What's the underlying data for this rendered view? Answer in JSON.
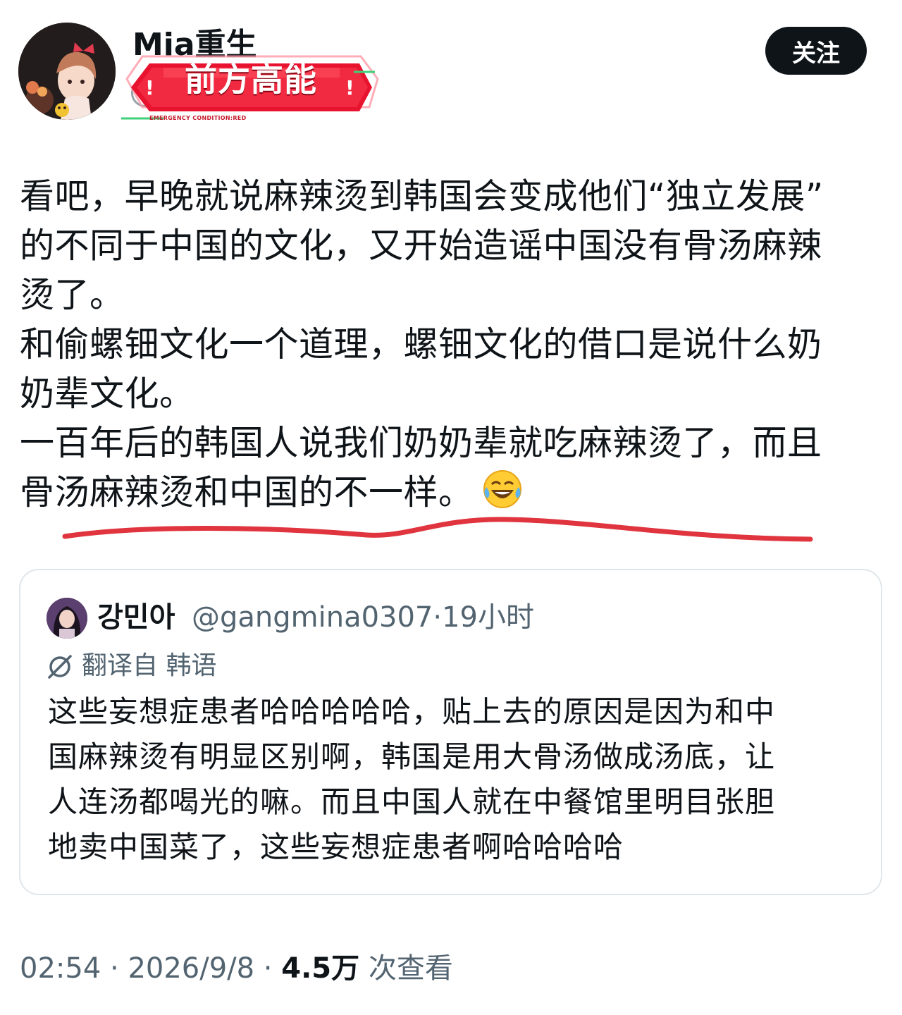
{
  "author": {
    "name": "Mia重生",
    "avatar_icon": "anime-girl-avatar-icon"
  },
  "sticker": {
    "text": "前方高能",
    "subtext": "EMERGENCY CONDITION:RED"
  },
  "follow_label": "关注",
  "post": {
    "lines": [
      "看吧，早晚就说麻辣烫到韩国会变成他们“独立发展”",
      "的不同于中国的文化，又开始造谣中国没有骨汤麻辣",
      "烫了。",
      "和偷螺钿文化一个道理，螺钿文化的借口是说什么奶",
      "奶辈文化。",
      "一百年后的韩国人说我们奶奶辈就吃麻辣烫了，而且",
      "骨汤麻辣烫和中国的不一样。"
    ],
    "emoji": "face-with-tears-of-joy-icon"
  },
  "quote": {
    "name": "강민아",
    "handle": "@gangmina0307",
    "time": "19小时",
    "translated_label": "翻译自 韩语",
    "lines": [
      "这些妄想症患者哈哈哈哈哈，贴上去的原因是因为和中",
      "国麻辣烫有明显区别啊，韩国是用大骨汤做成汤底，让",
      "人连汤都喝光的嘛。而且中国人就在中餐馆里明目张胆",
      "地卖中国菜了，这些妄想症患者啊哈哈哈哈"
    ]
  },
  "meta": {
    "time": "02:54",
    "date": "2026/9/8",
    "views_count": "4.5万",
    "views_label": "次查看"
  },
  "colors": {
    "accent_red": "#e0343f",
    "text_primary": "#0f1419",
    "text_secondary": "#536471",
    "border": "#e1e6ea"
  }
}
